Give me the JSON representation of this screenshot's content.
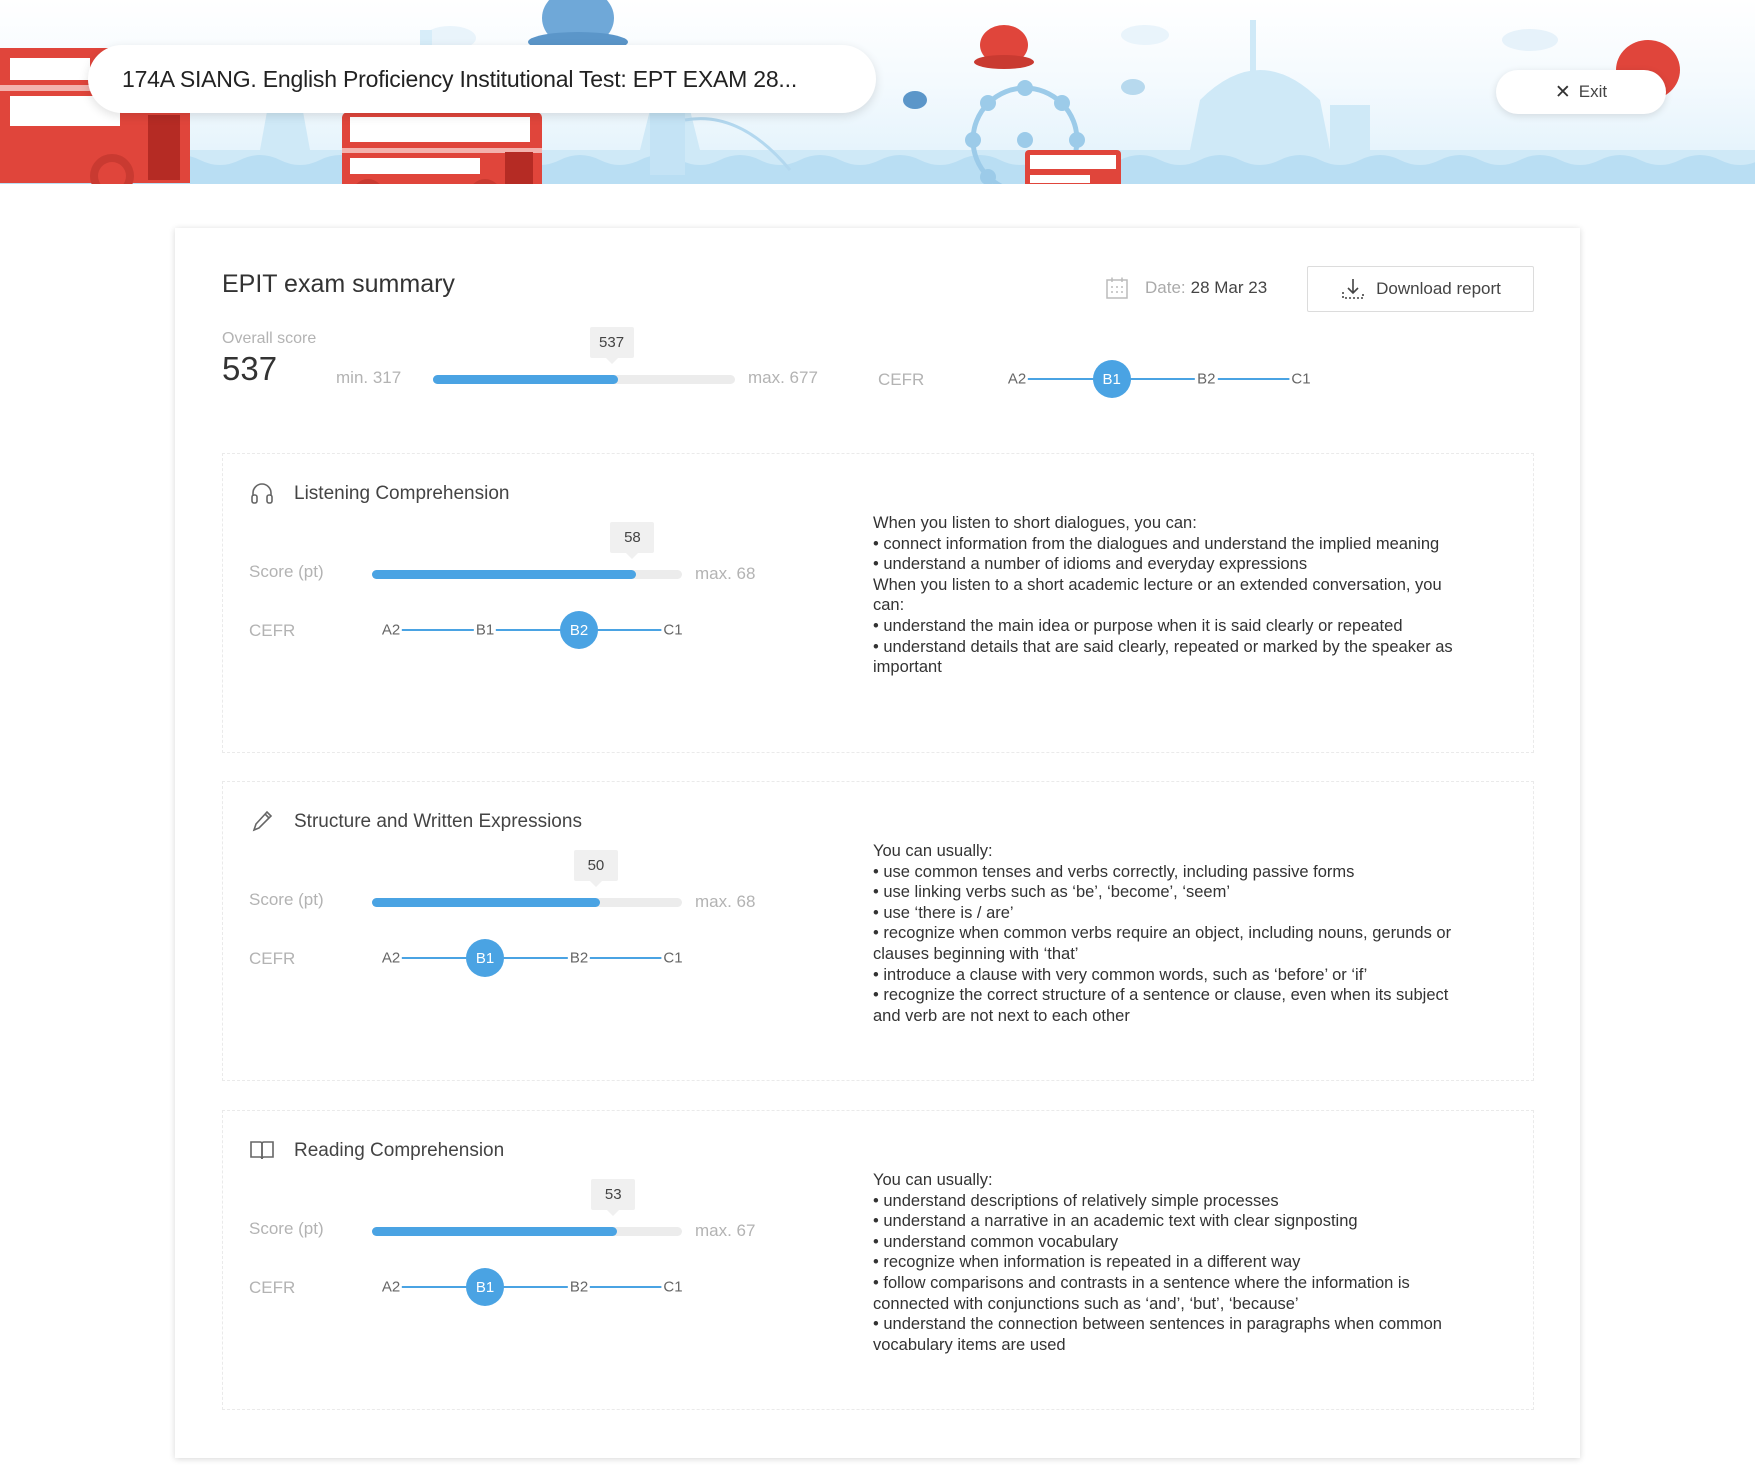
{
  "header": {
    "title": "174A SIANG. English Proficiency Institutional Test: EPT EXAM 28...",
    "exit_label": "Exit",
    "exit_icon": "close-icon"
  },
  "summary": {
    "title": "EPIT exam summary",
    "date_label": "Date:",
    "date_value": "28 Mar 23",
    "download_label": "Download report",
    "overall_label": "Overall score",
    "overall_value": "537",
    "min_label": "min. 317",
    "max_label": "max. 677",
    "score": 537,
    "min": 317,
    "max": 677,
    "cefr_label": "CEFR",
    "cefr_levels": [
      "A2",
      "B1",
      "B2",
      "C1"
    ],
    "cefr_active": "B1"
  },
  "sections": [
    {
      "title": "Listening Comprehension",
      "icon": "headphones-icon",
      "score_label": "Score (pt)",
      "score": 58,
      "score_text": "58",
      "max": 68,
      "max_label": "max. 68",
      "cefr_label": "CEFR",
      "cefr_levels": [
        "A2",
        "B1",
        "B2",
        "C1"
      ],
      "cefr_active": "B2",
      "description": [
        "When you listen to short dialogues, you can:",
        "• connect information from the dialogues and understand the implied meaning",
        "• understand a number of idioms and everyday expressions",
        "When you listen to a short academic lecture or an extended conversation, you can:",
        "• understand the main idea or purpose when it is said clearly or repeated",
        "• understand details that are said clearly, repeated or marked by the speaker as important"
      ]
    },
    {
      "title": "Structure and Written Expressions",
      "icon": "pencil-icon",
      "score_label": "Score (pt)",
      "score": 50,
      "score_text": "50",
      "max": 68,
      "max_label": "max. 68",
      "cefr_label": "CEFR",
      "cefr_levels": [
        "A2",
        "B1",
        "B2",
        "C1"
      ],
      "cefr_active": "B1",
      "description": [
        "You can usually:",
        "• use common tenses and verbs correctly, including passive forms",
        "• use linking verbs such as ‘be’, ‘become’, ‘seem’",
        "• use ‘there is / are’",
        "• recognize when common verbs require an object, including nouns, gerunds or clauses beginning with ‘that’",
        "• introduce a clause with very common words, such as ‘before’ or ‘if’",
        "• recognize the correct structure of a sentence or clause, even when its subject and verb are not next to each other"
      ]
    },
    {
      "title": "Reading Comprehension",
      "icon": "book-icon",
      "score_label": "Score (pt)",
      "score": 53,
      "score_text": "53",
      "max": 67,
      "max_label": "max. 67",
      "cefr_label": "CEFR",
      "cefr_levels": [
        "A2",
        "B1",
        "B2",
        "C1"
      ],
      "cefr_active": "B1",
      "description": [
        "You can usually:",
        "• understand descriptions of relatively simple processes",
        "• understand a narrative in an academic text with clear signposting",
        "• understand common vocabulary",
        "• recognize when information is repeated in a different way",
        "• follow comparisons and contrasts in a sentence where the information is connected with conjunctions such as ‘and’, ‘but’, ‘because’",
        "• understand the connection between sentences in paragraphs when common vocabulary items are used"
      ]
    }
  ],
  "colors": {
    "accent": "#4aa3e3",
    "bus_red": "#e0453b",
    "sky": "#dff1fb"
  }
}
